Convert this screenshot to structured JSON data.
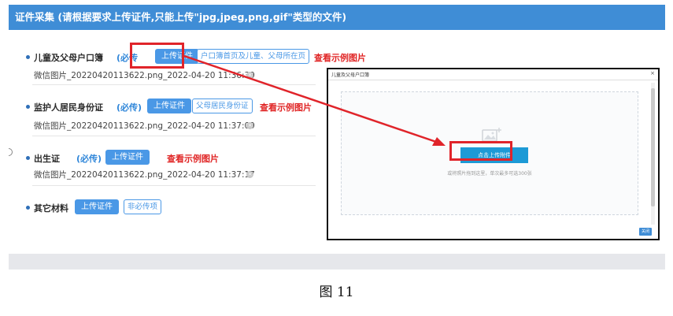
{
  "header": {
    "title": "证件采集 (请根据要求上传证件,只能上传\"jpg,jpeg,png,gif\"类型的文件)"
  },
  "sections": [
    {
      "label": "儿童及父母户口簿",
      "required": "(必传",
      "upload": "上传证件",
      "hint": "户口簿首页及儿童、父母所在页",
      "example": "查看示例图片",
      "file": "微信图片_20220420113622.png_2022-04-20 11:36:39"
    },
    {
      "label": "监护人居民身份证",
      "required": "(必传)",
      "upload": "上传证件",
      "hint": "父母居民身份证",
      "example": "查看示例图片",
      "file": "微信图片_20220420113622.png_2022-04-20 11:37:09"
    },
    {
      "label": "出生证",
      "required": "(必传)",
      "upload": "上传证件",
      "example": "查看示例图片",
      "file": "微信图片_20220420113622.png_2022-04-20 11:37:17"
    },
    {
      "label": "其它材料",
      "upload": "上传证件",
      "hint": "非必传项"
    }
  ],
  "dialog": {
    "title": "儿童及父母户口簿",
    "close": "×",
    "attach_button": "点击上传附件",
    "drop_tip": "或将照片拖到这里，单次最多可选300张",
    "footer_button": "关闭"
  },
  "caption": "图 11",
  "colors": {
    "header": "#3f8dd6",
    "button": "#4a98e6",
    "highlight": "#e0242a",
    "example": "#e02424"
  }
}
